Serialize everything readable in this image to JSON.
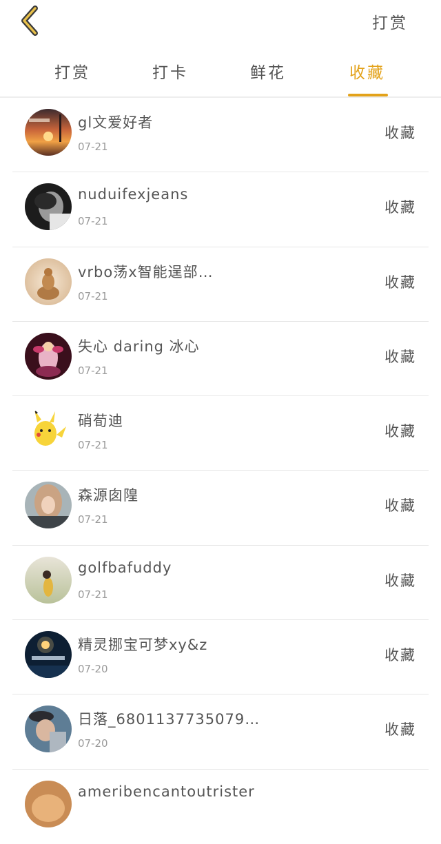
{
  "header": {
    "back_icon": "chevron-left-icon",
    "right_label": "打赏",
    "accent_color": "#E3A21A"
  },
  "tabs": [
    {
      "label": "打赏",
      "active": false
    },
    {
      "label": "打卡",
      "active": false
    },
    {
      "label": "鲜花",
      "active": false
    },
    {
      "label": "收藏",
      "active": true
    }
  ],
  "list": [
    {
      "name": "gl文爱好者",
      "date": "07-21",
      "action": "收藏"
    },
    {
      "name": "nuduifexjeans",
      "date": "07-21",
      "action": "收藏"
    },
    {
      "name": "vrbo荡x智能逞部…",
      "date": "07-21",
      "action": "收藏"
    },
    {
      "name": "失心 daring 冰心",
      "date": "07-21",
      "action": "收藏"
    },
    {
      "name": "硝荀迪",
      "date": "07-21",
      "action": "收藏"
    },
    {
      "name": "森源囱隍",
      "date": "07-21",
      "action": "收藏"
    },
    {
      "name": "golfbafuddy",
      "date": "07-21",
      "action": "收藏"
    },
    {
      "name": "精灵挪宝可梦xy&z",
      "date": "07-20",
      "action": "收藏"
    },
    {
      "name": "日落_6801137735079…",
      "date": "07-20",
      "action": "收藏"
    },
    {
      "name": "ameribencantoutrister",
      "date": "",
      "action": ""
    }
  ]
}
